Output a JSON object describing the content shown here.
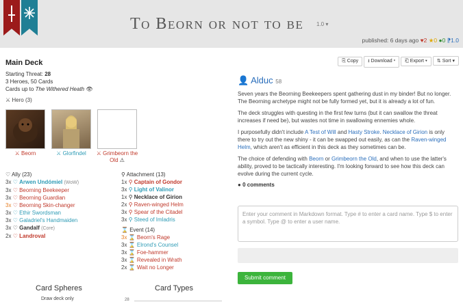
{
  "header": {
    "title": "To Beorn or not to be",
    "version": "1.0",
    "published": "published: 6 days ago",
    "likes": "2",
    "favorites": "0",
    "comments": "0",
    "version_count": "1.0"
  },
  "deck": {
    "title": "Main Deck",
    "threat_label": "Starting Threat:",
    "threat_value": "28",
    "summary": "3 Heroes, 50 Cards",
    "cards_up_to_prefix": "Cards up to",
    "cards_up_to_value": "The Withered Heath",
    "hero_section": "Hero (3)",
    "heroes": [
      {
        "name": "Beorn"
      },
      {
        "name": "Glorfindel"
      },
      {
        "name": "Grimbeorn the Old"
      }
    ],
    "ally_section": "Ally (23)",
    "allies": [
      {
        "qty": "3x",
        "name": "Arwen Undómiel",
        "extra": "(WoW)"
      },
      {
        "qty": "3x",
        "name": "Beorning Beekeeper",
        "extra": ""
      },
      {
        "qty": "3x",
        "name": "Beorning Guardian",
        "extra": ""
      },
      {
        "qty": "3x",
        "name": "Beorning Skin-changer",
        "extra": ""
      },
      {
        "qty": "3x",
        "name": "Ethir Swordsman",
        "extra": ""
      },
      {
        "qty": "3x",
        "name": "Galadriel's Handmaiden",
        "extra": ""
      },
      {
        "qty": "3x",
        "name": "Gandalf",
        "extra": "(Core)"
      },
      {
        "qty": "2x",
        "name": "Landroval",
        "extra": ""
      }
    ],
    "attachment_section": "Attachment (13)",
    "attachments": [
      {
        "qty": "1x",
        "name": "Captain of Gondor"
      },
      {
        "qty": "3x",
        "name": "Light of Valinor"
      },
      {
        "qty": "1x",
        "name": "Necklace of Girion"
      },
      {
        "qty": "2x",
        "name": "Raven-winged Helm"
      },
      {
        "qty": "3x",
        "name": "Spear of the Citadel"
      },
      {
        "qty": "3x",
        "name": "Steed of Imladris"
      }
    ],
    "event_section": "Event (14)",
    "events": [
      {
        "qty": "3x",
        "name": "Beorn's Rage"
      },
      {
        "qty": "3x",
        "name": "Elrond's Counsel"
      },
      {
        "qty": "3x",
        "name": "Foe-hammer"
      },
      {
        "qty": "3x",
        "name": "Revealed in Wrath"
      },
      {
        "qty": "2x",
        "name": "Wait no Longer"
      }
    ],
    "card_spheres": "Card Spheres",
    "card_types": "Card Types",
    "draw_deck_only": "Draw deck only",
    "tick_label": "28"
  },
  "toolbar": {
    "copy": "Copy",
    "download": "Download",
    "export": "Export",
    "sort": "Sort"
  },
  "description": {
    "author": "Alduc",
    "reputation": "58",
    "p1": "Seven years the Beorning Beekeepers spent gathering dust in my binder! But no longer. The Beorning archetype might not be fully formed yet, but it is already a lot of fun.",
    "p2": "The deck struggles with questing in the first few turns (but it can swallow the threat increases if need be), but wastes not time in swallowing ennemies whole.",
    "p3_a": "I purposefully didn't include ",
    "p3_link1": "A Test of Will",
    "p3_b": " and ",
    "p3_link2": "Hasty Stroke",
    "p3_c": ". ",
    "p3_link3": "Necklace of Girion",
    "p3_d": " is only there to try out the new shiny - it can be swapped out easily, as can the ",
    "p3_link4": "Raven-winged Helm",
    "p3_e": ", which aren't as efficient in this deck as they sometimes can be.",
    "p4_a": "The choice of defending with ",
    "p4_link1": "Beorn",
    "p4_b": " or ",
    "p4_link2": "Grimbeorn the Old",
    "p4_c": ", and when to use the latter's ability, proved to be tactically interesting. I'm looking forward to see how this deck can evolve during the current cycle.",
    "comments_count": "0 comments"
  },
  "comment_form": {
    "placeholder": "Enter your comment in Markdown format. Type # to enter a card name. Type $ to enter a symbol. Type @ to enter a user name.",
    "submit": "Submit comment"
  },
  "colors": {
    "leadership": "#c0392b",
    "lore": "#2e9bb5",
    "neutral": "#333333",
    "accent_green": "#3cb43c"
  }
}
